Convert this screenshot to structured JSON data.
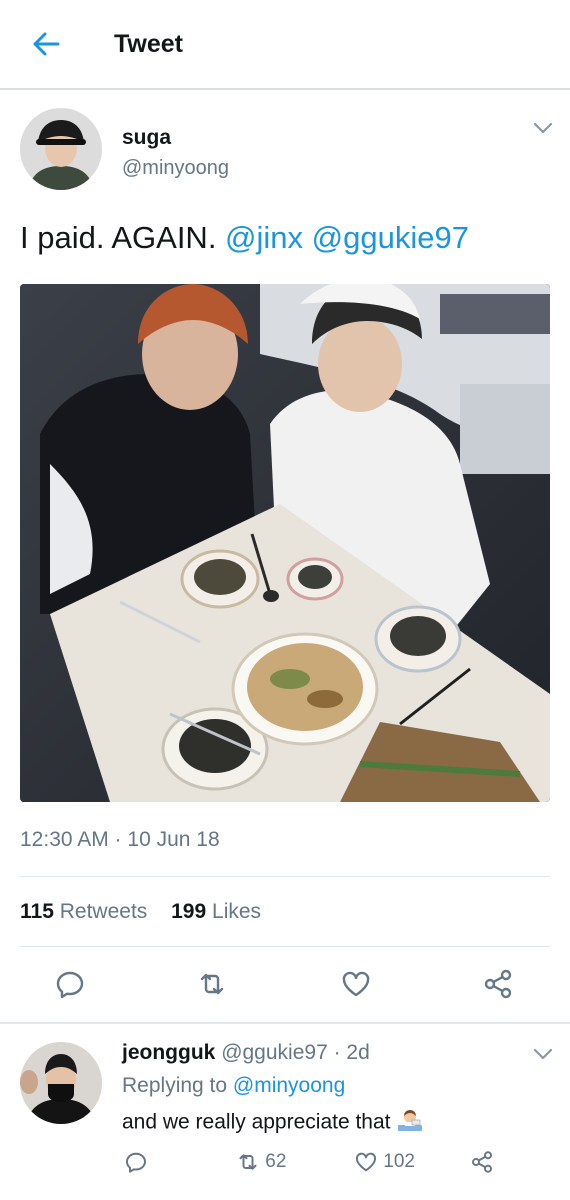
{
  "header": {
    "title": "Tweet"
  },
  "tweet": {
    "display_name": "suga",
    "handle": "@minyoong",
    "text_prefix": "I paid. AGAIN. ",
    "mentions": [
      "@jinx",
      "@ggukie97"
    ],
    "timestamp": "12:30 AM · 10 Jun 18",
    "stats": {
      "retweets_count": "115",
      "retweets_label": "Retweets",
      "likes_count": "199",
      "likes_label": "Likes"
    },
    "actions": [
      "reply-icon",
      "retweet-icon",
      "like-icon",
      "share-icon"
    ]
  },
  "reply": {
    "display_name": "jeongguk",
    "handle": "@ggukie97",
    "age": "· 2d",
    "replying_label": "Replying to",
    "replying_handle": "@minyoong",
    "text": "and we really appreciate that",
    "retweets": "62",
    "likes": "102"
  },
  "colors": {
    "accent": "#1b95e0",
    "muted": "#657786",
    "text": "#14171a"
  }
}
